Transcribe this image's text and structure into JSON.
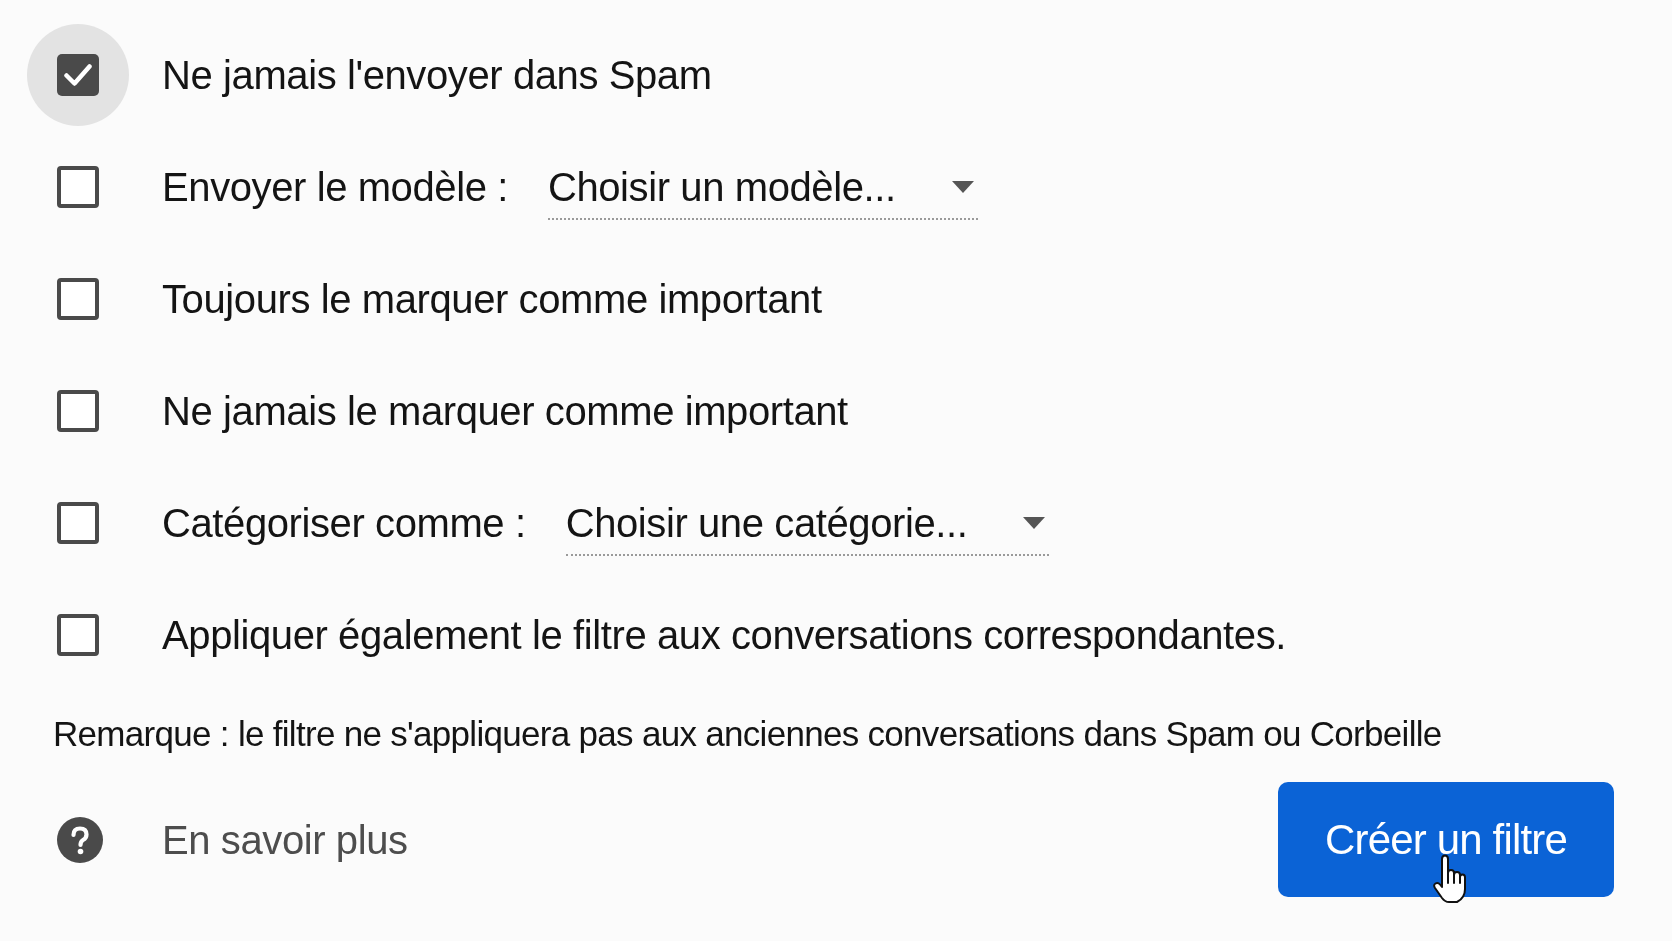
{
  "filter_actions": [
    {
      "kind": "checkbox",
      "label": "Ne jamais l'envoyer dans Spam",
      "checked": true,
      "focused": true
    },
    {
      "kind": "select",
      "label": "Envoyer le modèle :",
      "checked": false,
      "focused": false,
      "dropdown": {
        "value": "Choisir un modèle..."
      }
    },
    {
      "kind": "checkbox",
      "label": "Toujours le marquer comme important",
      "checked": false,
      "focused": false
    },
    {
      "kind": "checkbox",
      "label": "Ne jamais le marquer comme important",
      "checked": false,
      "focused": false
    },
    {
      "kind": "select",
      "label": "Catégoriser comme :",
      "checked": false,
      "focused": false,
      "dropdown": {
        "value": "Choisir une catégorie..."
      }
    },
    {
      "kind": "checkbox",
      "label": "Appliquer également le filtre aux conversations correspondantes.",
      "checked": false,
      "focused": false
    }
  ],
  "note": "Remarque : le filtre ne s'appliquera pas aux anciennes conversations dans Spam ou Corbeille",
  "help_link": {
    "label": "En savoir plus"
  },
  "create_button": {
    "label": "Créer un filtre",
    "hovered": true
  }
}
